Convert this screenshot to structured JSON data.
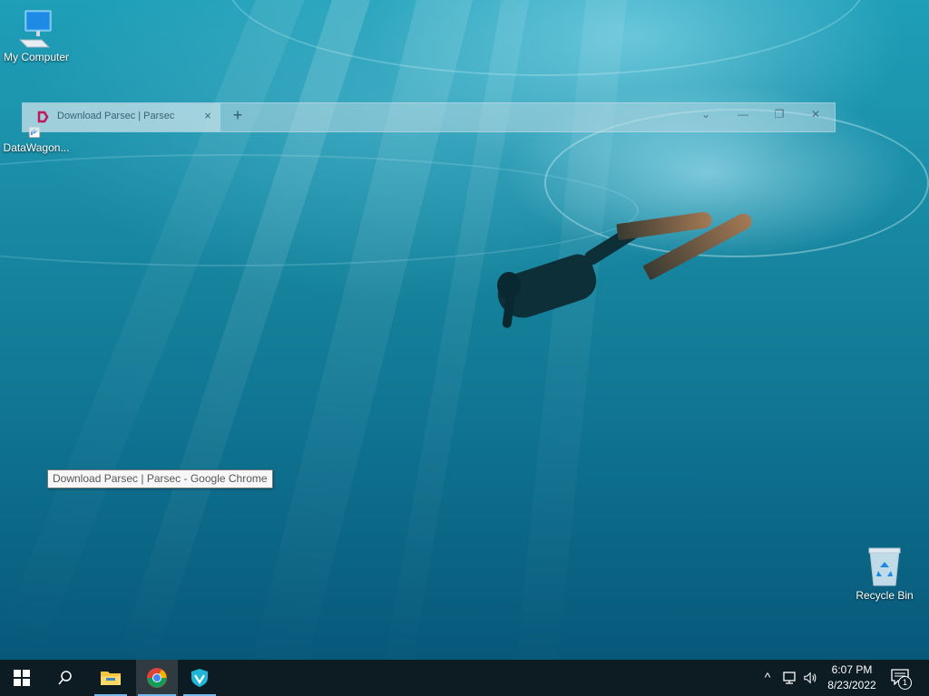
{
  "desktop": {
    "icons": [
      {
        "label": "My Computer",
        "icon": "computer-icon"
      },
      {
        "label": "DataWagon...",
        "icon": "shortcut-icon"
      },
      {
        "label": "Recycle Bin",
        "icon": "recycle-bin-icon"
      }
    ]
  },
  "chrome": {
    "tab_title": "Download Parsec | Parsec",
    "tab_close": "×",
    "new_tab": "+",
    "controls": {
      "dropdown": "⌄",
      "minimize": "—",
      "restore": "❐",
      "close": "✕"
    }
  },
  "tooltip": {
    "text": "Download Parsec | Parsec - Google Chrome"
  },
  "taskbar": {
    "items": [
      "start",
      "search",
      "file-explorer",
      "google-chrome",
      "vpn-app"
    ],
    "active_item": "google-chrome",
    "tray": {
      "chevron": "^",
      "time": "6:07 PM",
      "date": "8/23/2022",
      "notification_count": "1"
    }
  },
  "colors": {
    "taskbar": "#0d1b22",
    "accent_underline": "#76b9ed",
    "water_top": "#1f9fb8",
    "water_bottom": "#08587a"
  }
}
